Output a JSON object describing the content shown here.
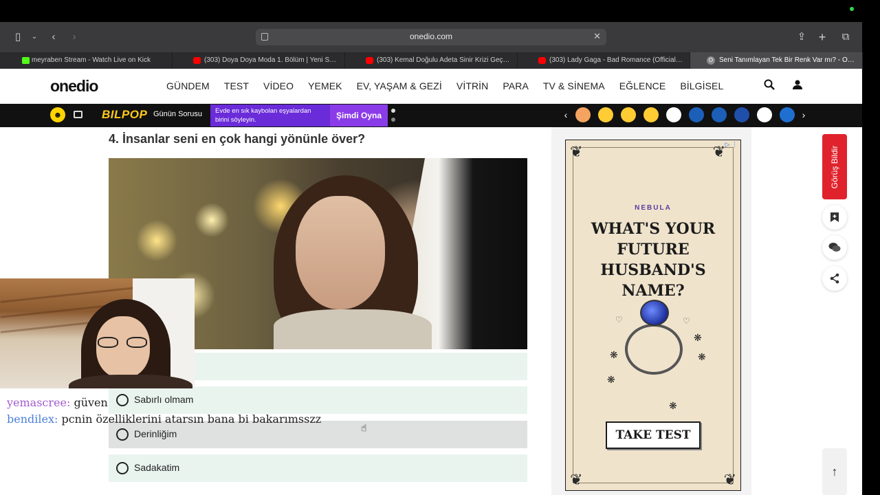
{
  "browser": {
    "address": "onedio.com",
    "tabs": [
      {
        "label": "meyraben Stream - Watch Live on Kick",
        "favicon": "kick-icon"
      },
      {
        "label": "(303) Doya Doya Moda 1. Bölüm | Yeni Sezon...",
        "favicon": "youtube-icon"
      },
      {
        "label": "(303) Kemal Doğulu Adeta Sinir Krizi Geçirdil...",
        "favicon": "youtube-icon"
      },
      {
        "label": "(303) Lady Gaga - Bad Romance (Official Mu...",
        "favicon": "youtube-icon"
      },
      {
        "label": "Seni Tanımlayan Tek Bir Renk Var mı? - Onedio",
        "favicon": "onedio-icon",
        "active": true
      }
    ]
  },
  "site": {
    "logo": "onedio",
    "nav": [
      "GÜNDEM",
      "TEST",
      "VİDEO",
      "YEMEK",
      "EV, YAŞAM & GEZİ",
      "VİTRİN",
      "PARA",
      "TV & SİNEMA",
      "EĞLENCE",
      "BİLGİSEL"
    ]
  },
  "promo_bar": {
    "bilpop": "BILPOP",
    "gunun": "Günün Sorusu",
    "question": "Evde en sık kaybolan eşyalardan birini söyleyin.",
    "play": "Şimdi Oyna",
    "reaction_colors": [
      "#f4a460",
      "#ffcc33",
      "#ffcc33",
      "#ffcc33",
      "#ffffff",
      "#1c5fb8",
      "#1c5fb8",
      "#1f4fa8",
      "#ffffff",
      "#1f6fd1"
    ]
  },
  "quiz": {
    "question": "4. İnsanlar seni en çok hangi yönünle över?",
    "options": [
      "Sabırlı olmam",
      "Derinliğim",
      "Sadakatim"
    ]
  },
  "chat": [
    {
      "user": "yemascree:",
      "message": " güven"
    },
    {
      "user": "bendilex:",
      "message": " pcnin özelliklerini atarsın bana bi bakarımsszz"
    }
  ],
  "ad": {
    "brand": "NEBULA",
    "headline_lines": [
      "WHAT'S YOUR",
      "FUTURE HUSBAND'S",
      "NAME?"
    ],
    "cta": "TAKE TEST"
  },
  "rail": {
    "feedback": "Görüş Bildir"
  }
}
